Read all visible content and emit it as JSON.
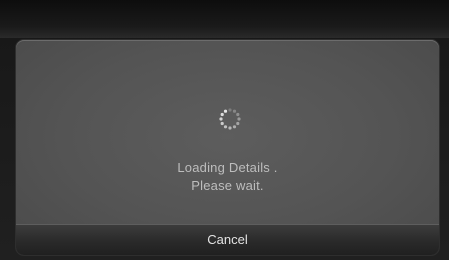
{
  "dialog": {
    "message_line_1": "Loading Details .",
    "message_line_2": "Please wait.",
    "cancel_label": "Cancel",
    "spinner_icon": "loading-spinner-icon"
  },
  "colors": {
    "dialog_background": "#555555",
    "text": "#bdbdbd",
    "cancel_text": "#e3e3e3"
  }
}
